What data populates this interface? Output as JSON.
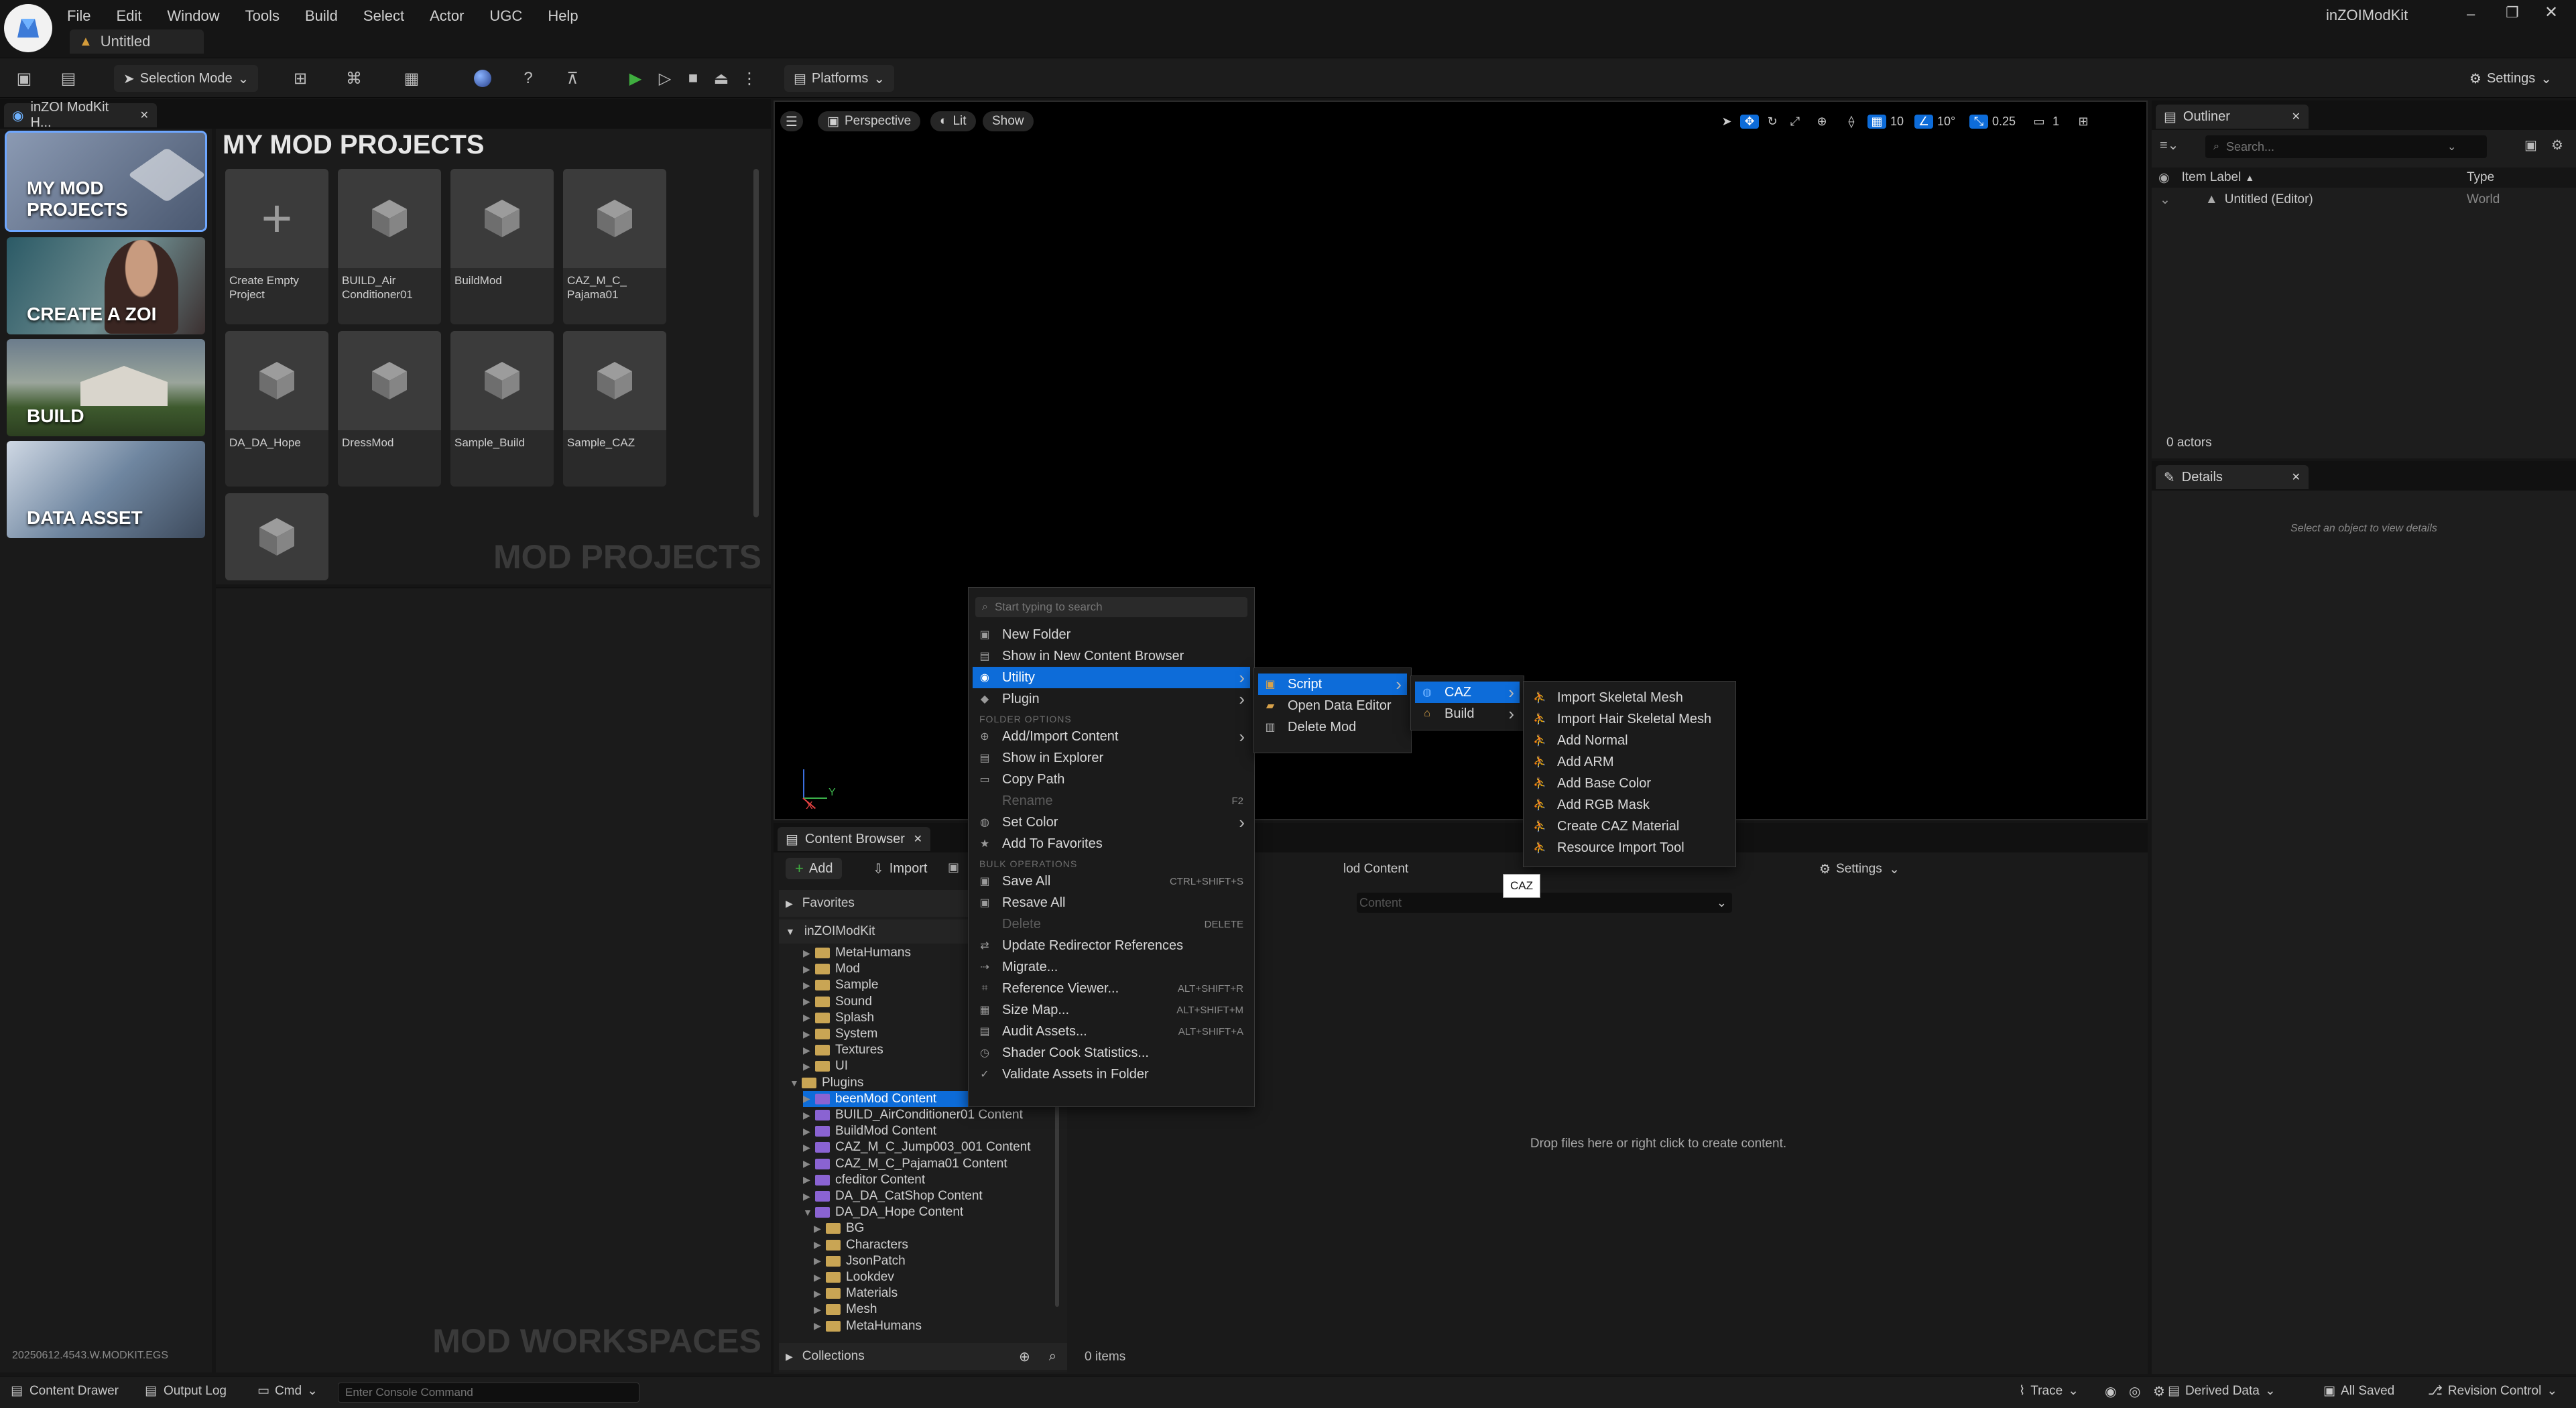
{
  "app": {
    "name": "inZOI ModKit",
    "title": "inZOIModKit",
    "doc_tab": "Untitled"
  },
  "menu": [
    "File",
    "Edit",
    "Window",
    "Tools",
    "Build",
    "Select",
    "Actor",
    "UGC",
    "Help"
  ],
  "toolbar": {
    "selection_mode": "Selection Mode",
    "platforms": "Platforms",
    "settings": "Settings"
  },
  "home_tab": {
    "label": "inZOI ModKit H..."
  },
  "categories": [
    {
      "label": "MY MOD PROJECTS",
      "color": "#6b7b93"
    },
    {
      "label": "CREATE A ZOI",
      "color": "#3a6f7a"
    },
    {
      "label": "BUILD",
      "color": "#4a5b3c"
    },
    {
      "label": "DATA ASSET",
      "color": "#5d6f85"
    }
  ],
  "projects": {
    "heading": "MY MOD PROJECTS",
    "watermark": "MOD PROJECTS",
    "items": [
      {
        "name": "Create Empty Project",
        "kind": "plus"
      },
      {
        "name": "BUILD_Air Conditioner01",
        "kind": "cube"
      },
      {
        "name": "BuildMod",
        "kind": "cube"
      },
      {
        "name": "CAZ_M_C_ Pajama01",
        "kind": "cube"
      },
      {
        "name": "DA_DA_Hope",
        "kind": "cube"
      },
      {
        "name": "DressMod",
        "kind": "cube"
      },
      {
        "name": "Sample_Build",
        "kind": "cube"
      },
      {
        "name": "Sample_CAZ",
        "kind": "cube"
      },
      {
        "name": "",
        "kind": "cube"
      }
    ]
  },
  "workspaces_watermark": "MOD WORKSPACES",
  "version": "20250612.4543.W.MODKIT.EGS",
  "viewport": {
    "perspective": "Perspective",
    "lit": "Lit",
    "show": "Show",
    "grid": "10",
    "angle": "10°",
    "scale": "0.25",
    "cam": "1"
  },
  "outliner": {
    "title": "Outliner",
    "search_placeholder": "Search...",
    "col_label": "Item Label",
    "col_type": "Type",
    "row_label": "Untitled (Editor)",
    "row_type": "World",
    "actors": "0 actors"
  },
  "details": {
    "title": "Details",
    "empty": "Select an object to view details"
  },
  "content_browser": {
    "title": "Content Browser",
    "add": "Add",
    "import": "Import",
    "settings": "Settings",
    "path_tail": "lod Content",
    "filter_tail": "Content",
    "favorites": "Favorites",
    "root": "inZOIModKit",
    "collections": "Collections",
    "drop_hint": "Drop files here or right click to create content.",
    "items_count": "0 items",
    "tree": [
      {
        "label": "MetaHumans",
        "indent": 1,
        "type": "folder"
      },
      {
        "label": "Mod",
        "indent": 1,
        "type": "folder"
      },
      {
        "label": "Sample",
        "indent": 1,
        "type": "folder"
      },
      {
        "label": "Sound",
        "indent": 1,
        "type": "folder"
      },
      {
        "label": "Splash",
        "indent": 1,
        "type": "folder"
      },
      {
        "label": "System",
        "indent": 1,
        "type": "folder"
      },
      {
        "label": "Textures",
        "indent": 1,
        "type": "folder"
      },
      {
        "label": "UI",
        "indent": 1,
        "type": "folder"
      },
      {
        "label": "Plugins",
        "indent": 0,
        "type": "folder"
      },
      {
        "label": "beenMod Content",
        "indent": 1,
        "type": "plugin"
      },
      {
        "label": "BUILD_AirConditioner01 Content",
        "indent": 1,
        "type": "plugin"
      },
      {
        "label": "BuildMod Content",
        "indent": 1,
        "type": "plugin"
      },
      {
        "label": "CAZ_M_C_Jump003_001 Content",
        "indent": 1,
        "type": "plugin"
      },
      {
        "label": "CAZ_M_C_Pajama01 Content",
        "indent": 1,
        "type": "plugin"
      },
      {
        "label": "cfeditor Content",
        "indent": 1,
        "type": "plugin"
      },
      {
        "label": "DA_DA_CatShop Content",
        "indent": 1,
        "type": "plugin"
      },
      {
        "label": "DA_DA_Hope Content",
        "indent": 1,
        "type": "plugin"
      },
      {
        "label": "BG",
        "indent": 2,
        "type": "folder"
      },
      {
        "label": "Characters",
        "indent": 2,
        "type": "folder"
      },
      {
        "label": "JsonPatch",
        "indent": 2,
        "type": "folder"
      },
      {
        "label": "Lookdev",
        "indent": 2,
        "type": "folder"
      },
      {
        "label": "Materials",
        "indent": 2,
        "type": "folder"
      },
      {
        "label": "Mesh",
        "indent": 2,
        "type": "folder"
      },
      {
        "label": "MetaHumans",
        "indent": 2,
        "type": "folder"
      }
    ]
  },
  "context_menu": {
    "search_placeholder": "Start typing to search",
    "items": [
      {
        "label": "New Folder",
        "icon": "folder-icon"
      },
      {
        "label": "Show in New Content Browser",
        "icon": "browser-icon"
      },
      {
        "label": "Utility",
        "icon": "utility-icon",
        "submenu": true,
        "selected": true
      },
      {
        "label": "Plugin",
        "icon": "plugin-icon",
        "submenu": true
      },
      {
        "header": "FOLDER OPTIONS"
      },
      {
        "label": "Add/Import Content",
        "icon": "import-icon",
        "submenu": true
      },
      {
        "label": "Show in Explorer",
        "icon": "explorer-icon"
      },
      {
        "label": "Copy Path",
        "icon": "copy-icon"
      },
      {
        "label": "Rename",
        "icon": "",
        "shortcut": "F2",
        "disabled": true
      },
      {
        "label": "Set Color",
        "icon": "palette-icon",
        "submenu": true
      },
      {
        "label": "Add To Favorites",
        "icon": "star-icon"
      },
      {
        "header": "BULK OPERATIONS"
      },
      {
        "label": "Save All",
        "icon": "save-icon",
        "shortcut": "CTRL+SHIFT+S"
      },
      {
        "label": "Resave All",
        "icon": "save-icon"
      },
      {
        "label": "Delete",
        "icon": "",
        "shortcut": "DELETE",
        "disabled": true
      },
      {
        "label": "Update Redirector References",
        "icon": "redirect-icon"
      },
      {
        "label": "Migrate...",
        "icon": "migrate-icon"
      },
      {
        "label": "Reference Viewer...",
        "icon": "ref-icon",
        "shortcut": "ALT+SHIFT+R"
      },
      {
        "label": "Size Map...",
        "icon": "sizemap-icon",
        "shortcut": "ALT+SHIFT+M"
      },
      {
        "label": "Audit Assets...",
        "icon": "audit-icon",
        "shortcut": "ALT+SHIFT+A"
      },
      {
        "label": "Shader Cook Statistics...",
        "icon": "stats-icon"
      },
      {
        "label": "Validate Assets in Folder",
        "icon": "validate-icon"
      }
    ]
  },
  "utility_menu": {
    "items": [
      {
        "label": "Script",
        "submenu": true,
        "selected": true
      },
      {
        "label": "Open Data Editor"
      },
      {
        "label": "Delete Mod"
      }
    ]
  },
  "script_menu": {
    "items": [
      {
        "label": "CAZ",
        "submenu": true,
        "selected": true
      },
      {
        "label": "Build",
        "submenu": true
      }
    ]
  },
  "caz_menu": {
    "items": [
      "Import Skeletal Mesh",
      "Import Hair Skeletal Mesh",
      "Add Normal",
      "Add ARM",
      "Add Base Color",
      "Add RGB Mask",
      "Create CAZ Material",
      "Resource Import Tool"
    ]
  },
  "tooltip": "CAZ",
  "statusbar": {
    "content_drawer": "Content Drawer",
    "output_log": "Output Log",
    "cmd": "Cmd",
    "console_placeholder": "Enter Console Command",
    "trace": "Trace",
    "derived": "Derived Data",
    "saved": "All Saved",
    "revision": "Revision Control"
  }
}
